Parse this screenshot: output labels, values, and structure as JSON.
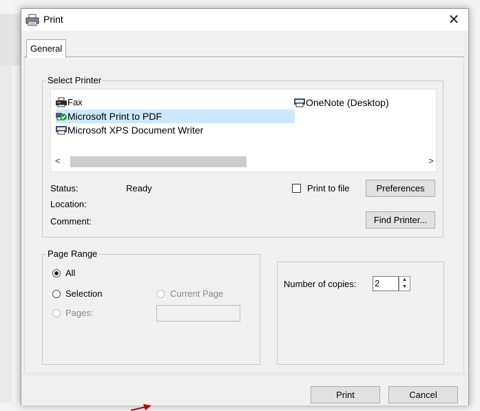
{
  "window": {
    "title": "Print",
    "close_glyph": "✕"
  },
  "tabs": [
    {
      "label": "General"
    }
  ],
  "select_printer": {
    "legend": "Select Printer",
    "printers": [
      {
        "name": "Fax",
        "icon": "fax-printer-icon"
      },
      {
        "name": "Microsoft Print to PDF",
        "icon": "default-printer-icon",
        "selected": true,
        "default": true
      },
      {
        "name": "Microsoft XPS Document Writer",
        "icon": "printer-icon"
      },
      {
        "name": "OneNote (Desktop)",
        "icon": "printer-icon"
      }
    ],
    "scroll_left": "<",
    "scroll_right": ">",
    "status_label": "Status:",
    "status_value": "Ready",
    "location_label": "Location:",
    "location_value": "",
    "comment_label": "Comment:",
    "comment_value": "",
    "print_to_file_label": "Print to file",
    "print_to_file_checked": false,
    "preferences_label": "Preferences",
    "find_printer_label": "Find Printer..."
  },
  "page_range": {
    "legend": "Page Range",
    "all_label": "All",
    "selection_label": "Selection",
    "current_page_label": "Current Page",
    "pages_label": "Pages:",
    "pages_value": "",
    "selected_option": "All"
  },
  "copies": {
    "label": "Number of copies:",
    "value": "2",
    "spin_up": "▲",
    "spin_down": "▼"
  },
  "buttons": {
    "print_label": "Print",
    "cancel_label": "Cancel"
  },
  "colors": {
    "selection": "#cce8ff",
    "accent_arrow": "#c00000"
  }
}
